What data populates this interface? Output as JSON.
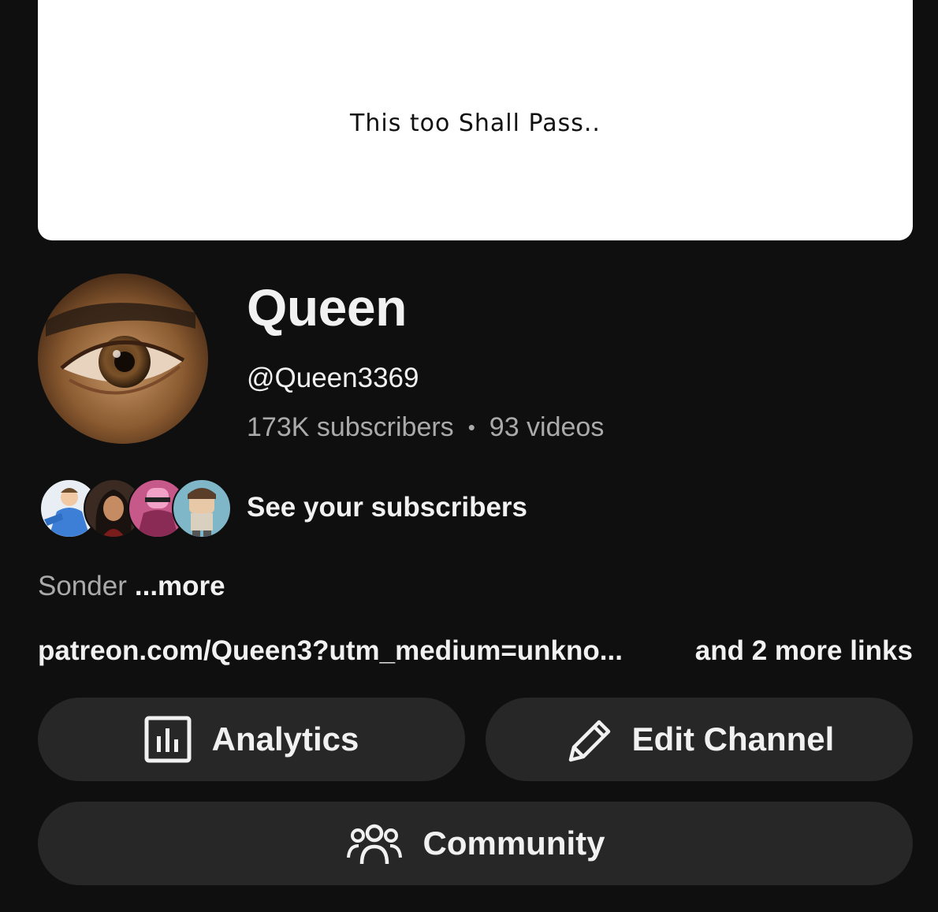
{
  "banner": {
    "text": "This too Shall Pass.."
  },
  "channel": {
    "name": "Queen",
    "handle": "@Queen3369",
    "subscribers": "173K subscribers",
    "separator": "•",
    "videos": "93 videos"
  },
  "subscribers_link": {
    "label": "See your subscribers"
  },
  "description": {
    "text": "Sonder",
    "more_label": "...more"
  },
  "links": {
    "primary": "patreon.com/Queen3?utm_medium=unkno...",
    "more": "and 2 more links"
  },
  "buttons": {
    "analytics": "Analytics",
    "edit_channel": "Edit Channel",
    "community": "Community"
  },
  "icons": {
    "analytics": "bar-chart-icon",
    "edit": "pencil-icon",
    "community": "people-icon"
  }
}
